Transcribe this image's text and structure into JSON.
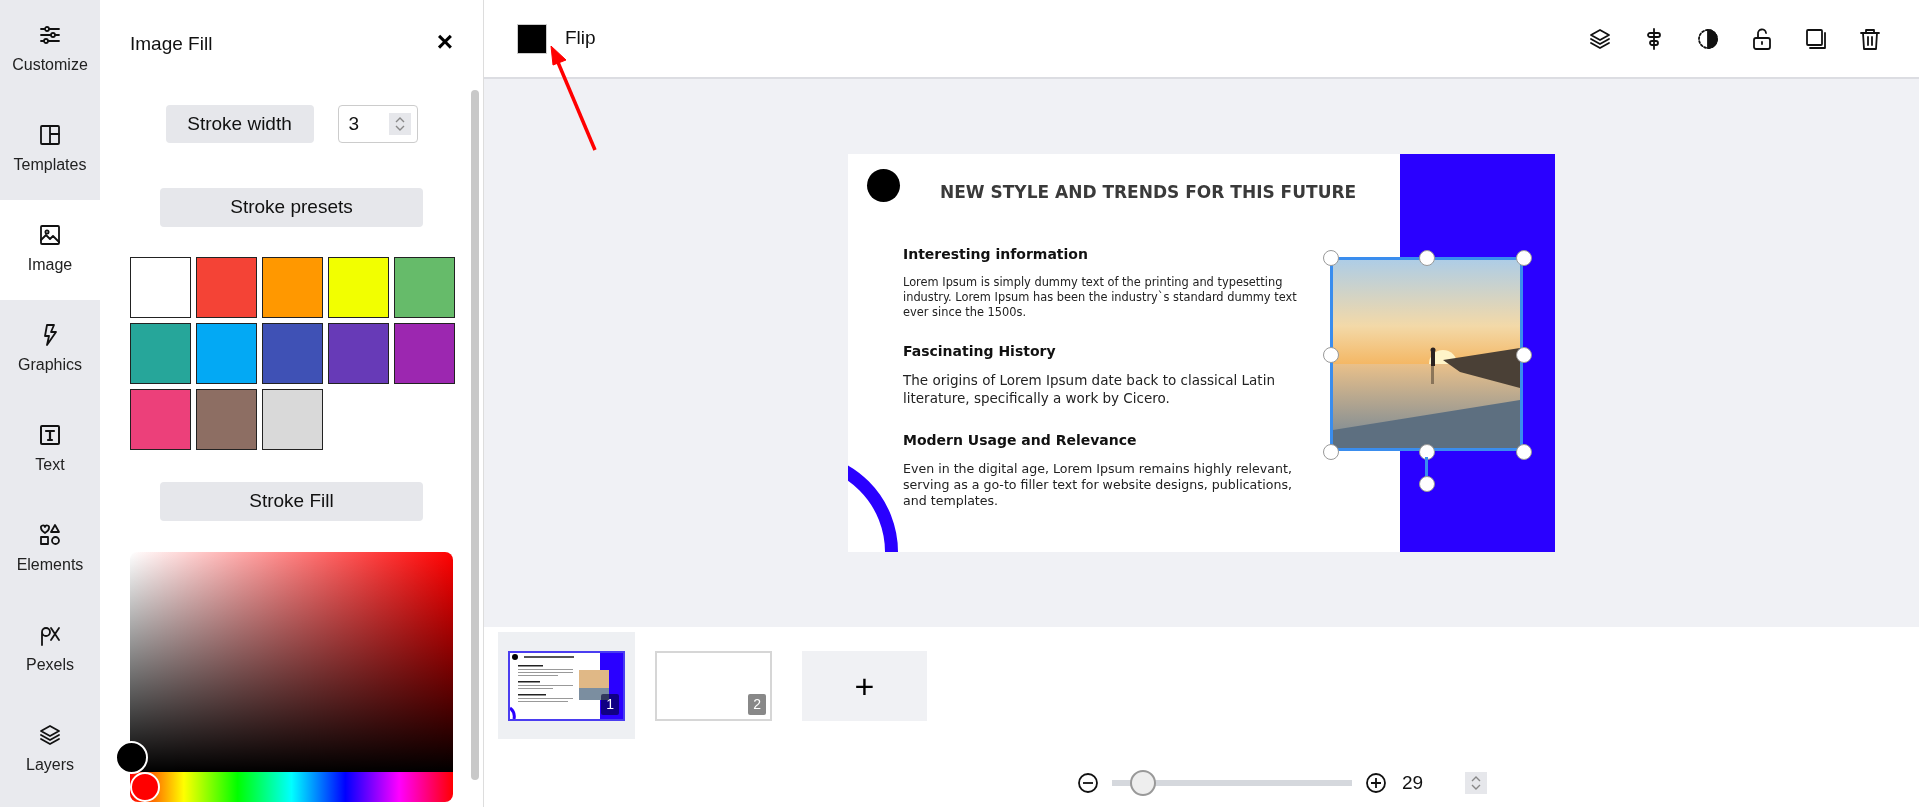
{
  "sidebar": {
    "items": [
      {
        "label": "Customize",
        "selected": false
      },
      {
        "label": "Templates",
        "selected": false
      },
      {
        "label": "Image",
        "selected": true
      },
      {
        "label": "Graphics",
        "selected": false
      },
      {
        "label": "Text",
        "selected": false
      },
      {
        "label": "Elements",
        "selected": false
      },
      {
        "label": "Pexels",
        "selected": false
      },
      {
        "label": "Layers",
        "selected": false
      }
    ]
  },
  "panel": {
    "title": "Image Fill",
    "close": "×",
    "stroke_width_label": "Stroke width",
    "stroke_width_value": "3",
    "presets_label": "Stroke presets",
    "swatches": [
      {
        "color": "#ffffff"
      },
      {
        "color": "#f44336"
      },
      {
        "color": "#ff9800"
      },
      {
        "color": "#f2ff00"
      },
      {
        "color": "#66bb6a"
      },
      {
        "color": "#26a69a"
      },
      {
        "color": "#03a9f4"
      },
      {
        "color": "#3f51b5"
      },
      {
        "color": "#673ab7"
      },
      {
        "color": "#9c27b0"
      },
      {
        "color": "#ec407a"
      },
      {
        "color": "#8d6e63"
      },
      {
        "color": "#d9d9d9"
      }
    ],
    "fill_label": "Stroke Fill",
    "hue": {
      "level": 0
    }
  },
  "toolbar": {
    "flip_label": "Flip"
  },
  "slide": {
    "title": "NEW STYLE AND TRENDS FOR THIS FUTURE",
    "image_selected": true,
    "sections": [
      {
        "heading": "Interesting information",
        "body": "Lorem Ipsum is simply dummy text of the printing and typesetting industry. Lorem Ipsum has been the industry`s standard dummy text ever since the 1500s."
      },
      {
        "heading": "Fascinating History",
        "body": "The origins of Lorem Ipsum date back to classical Latin literature, specifically a work by Cicero."
      },
      {
        "heading": "Modern Usage and Relevance",
        "body": "Even in the digital age, Lorem Ipsum remains highly relevant, serving as a go-to filler text for website designs, publications, and templates."
      }
    ]
  },
  "pages": [
    {
      "number": "1",
      "selected": true,
      "kind": "content"
    },
    {
      "number": "2",
      "selected": false,
      "kind": "blank"
    }
  ],
  "add_page": "+",
  "zoom": {
    "value": "29",
    "level": 0.13
  }
}
